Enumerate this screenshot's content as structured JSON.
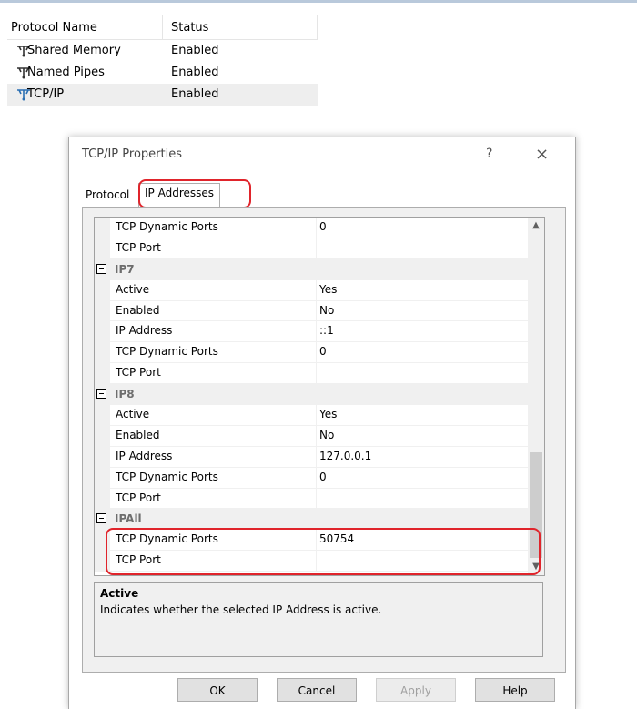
{
  "protocols": {
    "headers": {
      "name": "Protocol Name",
      "status": "Status"
    },
    "rows": [
      {
        "name": "Shared Memory",
        "status": "Enabled",
        "icon": "protocol-icon"
      },
      {
        "name": "Named Pipes",
        "status": "Enabled",
        "icon": "protocol-icon"
      },
      {
        "name": "TCP/IP",
        "status": "Enabled",
        "icon": "protocol-icon"
      }
    ]
  },
  "dialog": {
    "title": "TCP/IP Properties",
    "help": "?",
    "close": "×",
    "tabs": {
      "protocol": "Protocol",
      "ip_addresses": "IP Addresses"
    },
    "grid": [
      {
        "type": "prop",
        "name": "TCP Dynamic Ports",
        "value": "0"
      },
      {
        "type": "prop",
        "name": "TCP Port",
        "value": ""
      },
      {
        "type": "cat",
        "name": "IP7"
      },
      {
        "type": "prop",
        "name": "Active",
        "value": "Yes"
      },
      {
        "type": "prop",
        "name": "Enabled",
        "value": "No"
      },
      {
        "type": "prop",
        "name": "IP Address",
        "value": "::1"
      },
      {
        "type": "prop",
        "name": "TCP Dynamic Ports",
        "value": "0"
      },
      {
        "type": "prop",
        "name": "TCP Port",
        "value": ""
      },
      {
        "type": "cat",
        "name": "IP8"
      },
      {
        "type": "prop",
        "name": "Active",
        "value": "Yes"
      },
      {
        "type": "prop",
        "name": "Enabled",
        "value": "No"
      },
      {
        "type": "prop",
        "name": "IP Address",
        "value": "127.0.0.1"
      },
      {
        "type": "prop",
        "name": "TCP Dynamic Ports",
        "value": "0"
      },
      {
        "type": "prop",
        "name": "TCP Port",
        "value": ""
      },
      {
        "type": "cat",
        "name": "IPAll"
      },
      {
        "type": "prop",
        "name": "TCP Dynamic Ports",
        "value": "50754"
      },
      {
        "type": "prop",
        "name": "TCP Port",
        "value": ""
      }
    ],
    "scroll_up": "▲",
    "scroll_down": "▼",
    "description": {
      "title": "Active",
      "text": "Indicates whether the selected IP Address is active."
    },
    "buttons": {
      "ok": "OK",
      "cancel": "Cancel",
      "apply": "Apply",
      "help": "Help"
    }
  },
  "colors": {
    "highlight": "#e0242b",
    "panel": "#f0f0f0",
    "category_text": "#6d6d6d"
  }
}
